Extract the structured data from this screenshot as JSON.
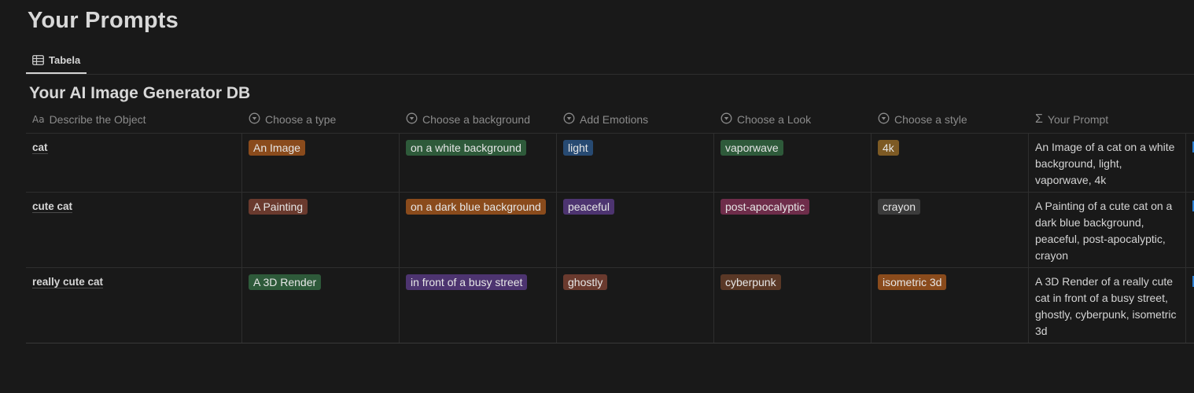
{
  "page": {
    "title": "Your Prompts"
  },
  "views": {
    "active_tab": "Tabela"
  },
  "database": {
    "title": "Your AI Image Generator DB"
  },
  "columns": [
    {
      "label": "Describe the Object",
      "icon": "aa-text-icon"
    },
    {
      "label": "Choose a type",
      "icon": "select-icon"
    },
    {
      "label": "Choose a background",
      "icon": "select-icon"
    },
    {
      "label": "Add Emotions",
      "icon": "select-icon"
    },
    {
      "label": "Choose a Look",
      "icon": "select-icon"
    },
    {
      "label": "Choose a style",
      "icon": "select-icon"
    },
    {
      "label": "Your Prompt",
      "icon": "sigma-icon"
    }
  ],
  "header_icon_text": {
    "aa": "Aa",
    "sigma": "Σ"
  },
  "rows": [
    {
      "object": "cat",
      "type": {
        "label": "An Image",
        "color": "#8a4b1c"
      },
      "background": {
        "label": "on a white background",
        "color": "#2e5a3a"
      },
      "emotion": {
        "label": "light",
        "color": "#274a72"
      },
      "look": {
        "label": "vaporwave",
        "color": "#2e5a3a"
      },
      "style": {
        "label": "4k",
        "color": "#7d5a24"
      },
      "prompt": "An Image of a cat on a white background, light, vaporwave, 4k"
    },
    {
      "object": "cute cat",
      "type": {
        "label": "A Painting",
        "color": "#6a3a2e"
      },
      "background": {
        "label": "on a dark blue background",
        "color": "#8a4b1c"
      },
      "emotion": {
        "label": "peaceful",
        "color": "#4d3470"
      },
      "look": {
        "label": "post-apocalyptic",
        "color": "#6e2d4a"
      },
      "style": {
        "label": "crayon",
        "color": "#3b3b3b"
      },
      "prompt": "A Painting of a cute cat on a dark blue background, peaceful, post-apocalyptic, crayon"
    },
    {
      "object": "really cute cat",
      "type": {
        "label": "A 3D Render",
        "color": "#2e5a3a"
      },
      "background": {
        "label": "in front of a busy street",
        "color": "#4d3470"
      },
      "emotion": {
        "label": "ghostly",
        "color": "#6a3a2e"
      },
      "look": {
        "label": "cyberpunk",
        "color": "#5a3826"
      },
      "style": {
        "label": "isometric 3d",
        "color": "#8a4b1c"
      },
      "prompt": "A 3D Render of a really cute cat in front of a busy street, ghostly, cyberpunk, isometric 3d"
    }
  ]
}
